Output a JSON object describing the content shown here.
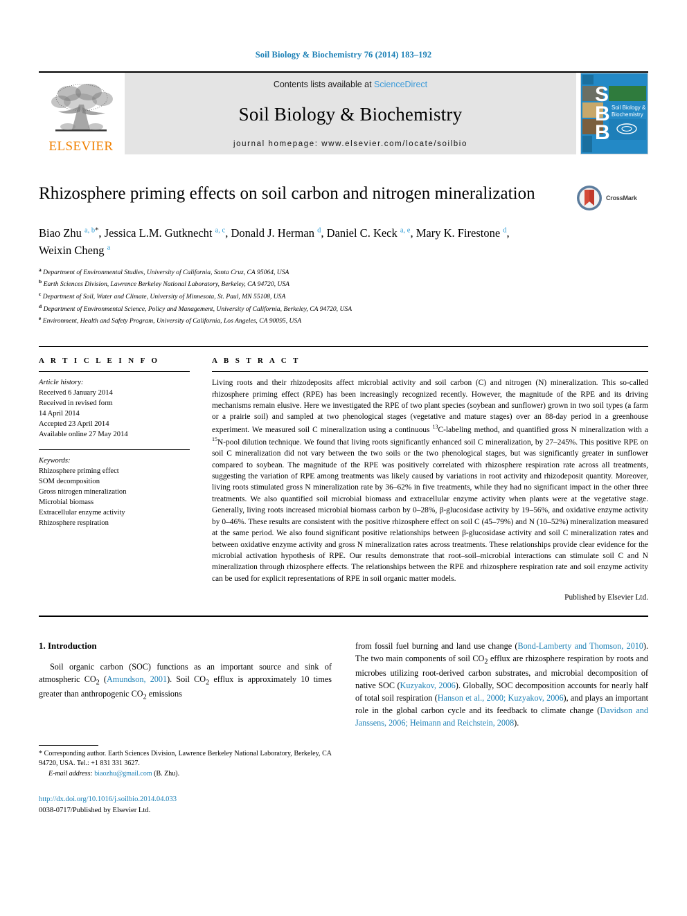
{
  "running_head": "Soil Biology & Biochemistry 76 (2014) 183–192",
  "masthead": {
    "publisher_name": "ELSEVIER",
    "contents_prefix": "Contents lists available at ",
    "contents_link": "ScienceDirect",
    "journal_name": "Soil Biology & Biochemistry",
    "homepage": "journal homepage: www.elsevier.com/locate/soilbio",
    "cover_letters": [
      "S",
      "B",
      "B"
    ],
    "cover_caption_line1": "Soil Biology &",
    "cover_caption_line2": "Biochemistry"
  },
  "article": {
    "title": "Rhizosphere priming effects on soil carbon and nitrogen mineralization",
    "crossmark_label": "CrossMark",
    "authors_html": "Biao Zhu <sup>a, b</sup><sup class=\"star\">*</sup>, Jessica L.M. Gutknecht <sup>a, c</sup>, Donald J. Herman <sup>d</sup>, Daniel C. Keck <sup>a, e</sup>, Mary K. Firestone <sup>d</sup>, Weixin Cheng <sup>a</sup>",
    "affiliations": [
      {
        "mark": "a",
        "text": "Department of Environmental Studies, University of California, Santa Cruz, CA 95064, USA"
      },
      {
        "mark": "b",
        "text": "Earth Sciences Division, Lawrence Berkeley National Laboratory, Berkeley, CA 94720, USA"
      },
      {
        "mark": "c",
        "text": "Department of Soil, Water and Climate, University of Minnesota, St. Paul, MN 55108, USA"
      },
      {
        "mark": "d",
        "text": "Department of Environmental Science, Policy and Management, University of California, Berkeley, CA 94720, USA"
      },
      {
        "mark": "e",
        "text": "Environment, Health and Safety Program, University of California, Los Angeles, CA 90095, USA"
      }
    ]
  },
  "article_info": {
    "heading": "A R T I C L E  I N F O",
    "history_title": "Article history:",
    "history": [
      "Received 6 January 2014",
      "Received in revised form",
      "14 April 2014",
      "Accepted 23 April 2014",
      "Available online 27 May 2014"
    ],
    "keywords_title": "Keywords:",
    "keywords": [
      "Rhizosphere priming effect",
      "SOM decomposition",
      "Gross nitrogen mineralization",
      "Microbial biomass",
      "Extracellular enzyme activity",
      "Rhizosphere respiration"
    ]
  },
  "abstract": {
    "heading": "A B S T R A C T",
    "body_html": "Living roots and their rhizodeposits affect microbial activity and soil carbon (C) and nitrogen (N) mineralization. This so-called rhizosphere priming effect (RPE) has been increasingly recognized recently. However, the magnitude of the RPE and its driving mechanisms remain elusive. Here we investigated the RPE of two plant species (soybean and sunflower) grown in two soil types (a farm or a prairie soil) and sampled at two phenological stages (vegetative and mature stages) over an 88-day period in a greenhouse experiment. We measured soil C mineralization using a continuous <sup>13</sup>C-labeling method, and quantified gross N mineralization with a <sup>15</sup>N-pool dilution technique. We found that living roots significantly enhanced soil C mineralization, by 27–245%. This positive RPE on soil C mineralization did not vary between the two soils or the two phenological stages, but was significantly greater in sunflower compared to soybean. The magnitude of the RPE was positively correlated with rhizosphere respiration rate across all treatments, suggesting the variation of RPE among treatments was likely caused by variations in root activity and rhizodeposit quantity. Moreover, living roots stimulated gross N mineralization rate by 36–62% in five treatments, while they had no significant impact in the other three treatments. We also quantified soil microbial biomass and extracellular enzyme activity when plants were at the vegetative stage. Generally, living roots increased microbial biomass carbon by 0–28%, β-glucosidase activity by 19–56%, and oxidative enzyme activity by 0–46%. These results are consistent with the positive rhizosphere effect on soil C (45–79%) and N (10–52%) mineralization measured at the same period. We also found significant positive relationships between β-glucosidase activity and soil C mineralization rates and between oxidative enzyme activity and gross N mineralization rates across treatments. These relationships provide clear evidence for the microbial activation hypothesis of RPE. Our results demonstrate that root–soil–microbial interactions can stimulate soil C and N mineralization through rhizosphere effects. The relationships between the RPE and rhizosphere respiration rate and soil enzyme activity can be used for explicit representations of RPE in soil organic matter models.",
    "published_by": "Published by Elsevier Ltd."
  },
  "introduction": {
    "section_title": "1. Introduction",
    "left_par_html": "Soil organic carbon (SOC) functions as an important source and sink of atmospheric CO<sub>2</sub> (<span class=\"lnk\">Amundson, 2001</span>). Soil CO<sub>2</sub> efflux is approximately 10 times greater than anthropogenic CO<sub>2</sub> emissions",
    "right_par_html": "from fossil fuel burning and land use change (<span class=\"lnk\">Bond-Lamberty and Thomson, 2010</span>). The two main components of soil CO<sub>2</sub> efflux are rhizosphere respiration by roots and microbes utilizing root-derived carbon substrates, and microbial decomposition of native SOC (<span class=\"lnk\">Kuzyakov, 2006</span>). Globally, SOC decomposition accounts for nearly half of total soil respiration (<span class=\"lnk\">Hanson et al., 2000; Kuzyakov, 2006</span>), and plays an important role in the global carbon cycle and its feedback to climate change (<span class=\"lnk\">Davidson and Janssens, 2006; Heimann and Reichstein, 2008</span>)."
  },
  "footer": {
    "corresponding_html": "* Corresponding author. Earth Sciences Division, Lawrence Berkeley National Laboratory, Berkeley, CA 94720, USA. Tel.: +1 831 331 3627.",
    "email_label": "E-mail address:",
    "email_address": "biaozhu@gmail.com",
    "email_owner": "(B. Zhu).",
    "doi_url": "http://dx.doi.org/10.1016/j.soilbio.2014.04.033",
    "issn_line": "0038-0717/Published by Elsevier Ltd."
  },
  "colors": {
    "link_blue": "#1a7fb5",
    "sciencedirect_blue": "#3b9ad9",
    "elsevier_orange": "#f08000",
    "cover_blue": "#2389c6",
    "band_gray": "#e4e4e4"
  }
}
